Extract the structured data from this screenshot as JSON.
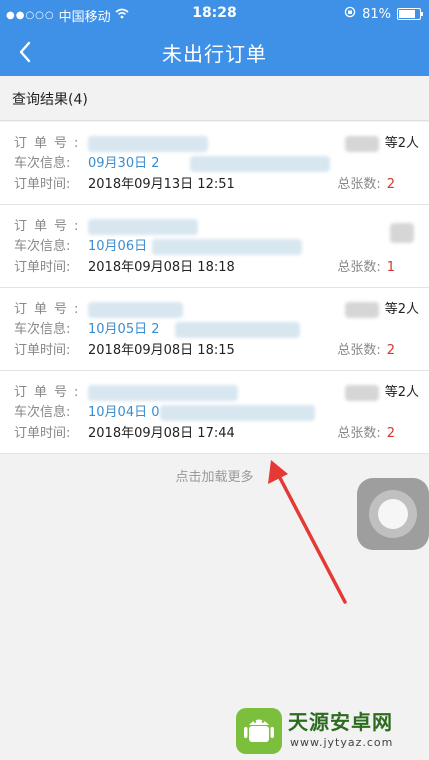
{
  "status_bar": {
    "signal_dots": "●●○○○",
    "carrier": "中国移动",
    "time": "18:28",
    "battery": "81%",
    "battery_level": 0.81
  },
  "nav": {
    "title": "未出行订单",
    "back_icon": "chevron-left-icon"
  },
  "results": {
    "label": "查询结果(4)"
  },
  "labels": {
    "order_no": "订单号:",
    "train_info": "车次信息:",
    "order_time": "订单时间:",
    "total_tickets": "总张数:"
  },
  "orders": [
    {
      "train_info": "09月30日 2",
      "order_time": "2018年09月13日 12:51",
      "passengers": "等2人",
      "total": "2"
    },
    {
      "train_info": "10月06日",
      "order_time": "2018年09月08日 18:18",
      "passengers": "",
      "total": "1"
    },
    {
      "train_info": "10月05日 2",
      "order_time": "2018年09月08日 18:15",
      "passengers": "等2人",
      "total": "2"
    },
    {
      "train_info": "10月04日 0",
      "order_time": "2018年09月08日 17:44",
      "passengers": "等2人",
      "total": "2"
    }
  ],
  "load_more": "点击加载更多",
  "watermark": {
    "title": "天源安卓网",
    "url": "www.jytyaz.com"
  },
  "colors": {
    "primary": "#3f91e8",
    "highlight": "#d9342b",
    "train_text": "#3b8ccf"
  }
}
